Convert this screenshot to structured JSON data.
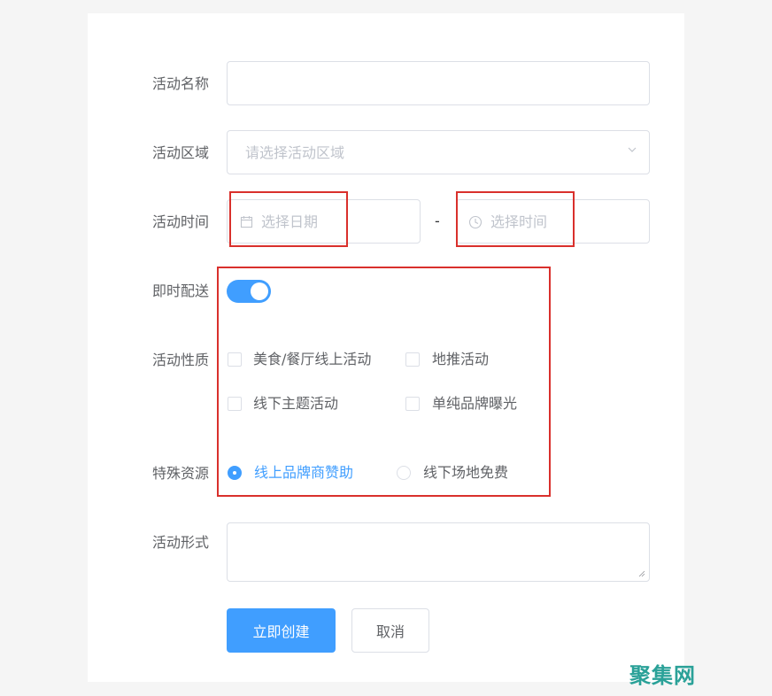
{
  "form": {
    "name_label": "活动名称",
    "region_label": "活动区域",
    "region_placeholder": "请选择活动区域",
    "time_label": "活动时间",
    "date_placeholder": "选择日期",
    "time_separator": "-",
    "time_placeholder": "选择时间",
    "delivery_label": "即时配送",
    "delivery_on": true,
    "nature_label": "活动性质",
    "nature_options": [
      "美食/餐厅线上活动",
      "地推活动",
      "线下主题活动",
      "单纯品牌曝光"
    ],
    "resource_label": "特殊资源",
    "resource_options": [
      "线上品牌商赞助",
      "线下场地免费"
    ],
    "resource_selected": "线上品牌商赞助",
    "form_label": "活动形式",
    "create_button": "立即创建",
    "cancel_button": "取消"
  },
  "colors": {
    "primary": "#409eff",
    "highlight_box": "#d9302c"
  },
  "watermark": "聚集网"
}
